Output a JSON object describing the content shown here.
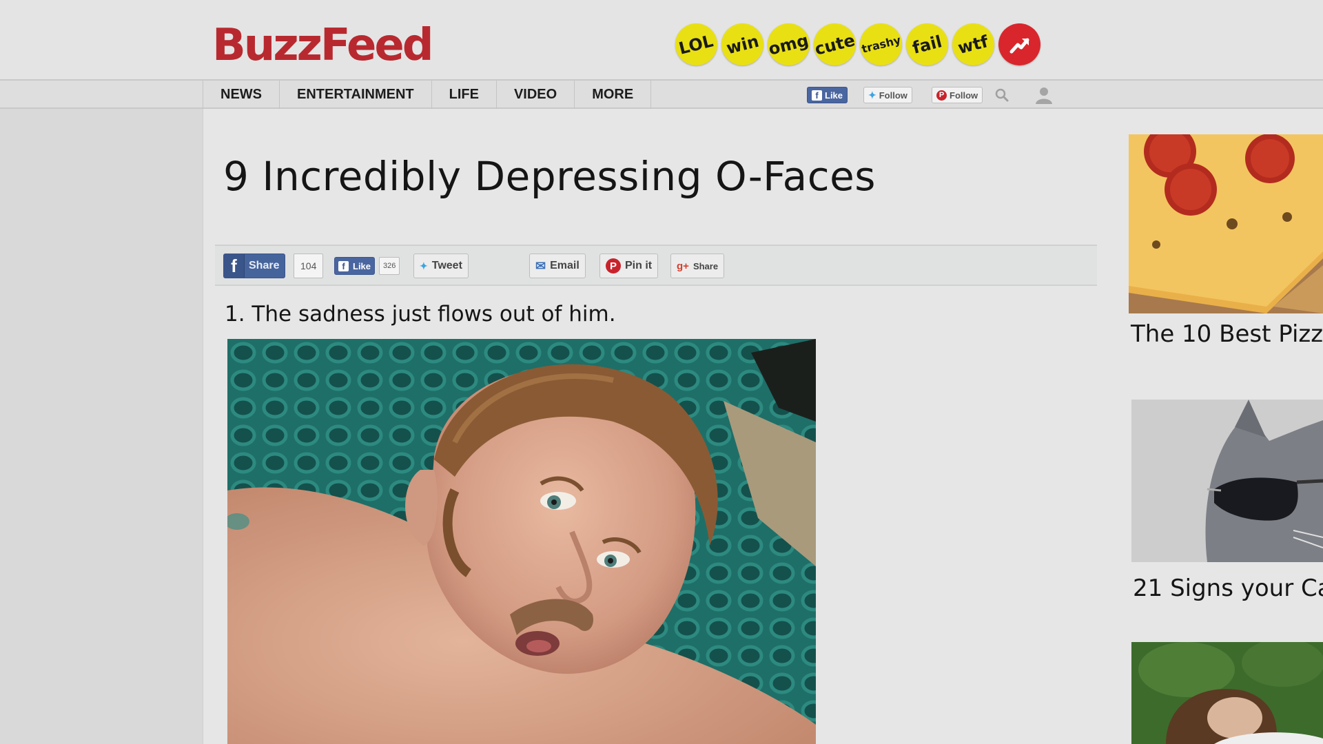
{
  "header": {
    "logo": "BuzzFeed",
    "badges": [
      "LOL",
      "win",
      "omg",
      "cute",
      "trashy",
      "fail",
      "wtf"
    ],
    "trending_icon": "trending-arrow-icon"
  },
  "nav": {
    "items": [
      "NEWS",
      "ENTERTAINMENT",
      "LIFE",
      "VIDEO",
      "MORE"
    ],
    "social": {
      "facebook": "Like",
      "twitter": "Follow",
      "pinterest": "Follow"
    },
    "icons": [
      "search-icon",
      "user-icon"
    ]
  },
  "article": {
    "title": "9 Incredibly Depressing O-Faces",
    "share": {
      "facebook_share": "Share",
      "facebook_share_count": "104",
      "facebook_like": "Like",
      "facebook_like_count": "326",
      "tweet": "Tweet",
      "email": "Email",
      "pin": "Pin it",
      "gplus": "Share"
    },
    "item_1_caption": "1. The sadness just flows out of him."
  },
  "sidebar": {
    "items": [
      {
        "title": "The 10 Best Pizz"
      },
      {
        "title": "21 Signs your Ca"
      }
    ]
  },
  "colors": {
    "brand_red": "#b8292f",
    "badge_yellow": "#e9e014",
    "facebook_blue": "#46649c"
  }
}
